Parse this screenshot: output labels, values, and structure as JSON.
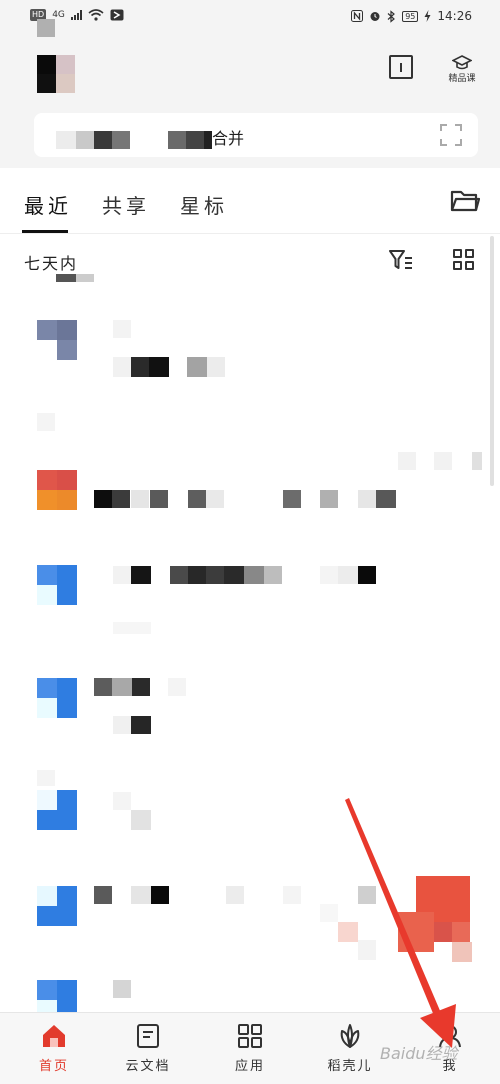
{
  "status_bar": {
    "hd": "HD",
    "network": "4G",
    "battery": "95",
    "time": "14:26"
  },
  "header": {
    "course_label": "精品课"
  },
  "search": {
    "text": "合并"
  },
  "tabs": [
    {
      "label": "最近",
      "active": true
    },
    {
      "label": "共享",
      "active": false
    },
    {
      "label": "星标",
      "active": false
    }
  ],
  "section": {
    "title": "七天内"
  },
  "bottom_nav": [
    {
      "label": "首页",
      "icon": "home-icon",
      "active": true
    },
    {
      "label": "云文档",
      "icon": "document-icon",
      "active": false
    },
    {
      "label": "应用",
      "icon": "apps-grid-icon",
      "active": false
    },
    {
      "label": "稻壳儿",
      "icon": "leaf-icon",
      "active": false
    },
    {
      "label": "我",
      "icon": "person-icon",
      "active": false
    }
  ],
  "watermark": "Baidu经验",
  "colors": {
    "accent_red": "#e23b2d",
    "file_blue": "#2f7de1",
    "file_red": "#e0564a",
    "file_orange": "#f0902a",
    "file_slate": "#7a86a8"
  }
}
